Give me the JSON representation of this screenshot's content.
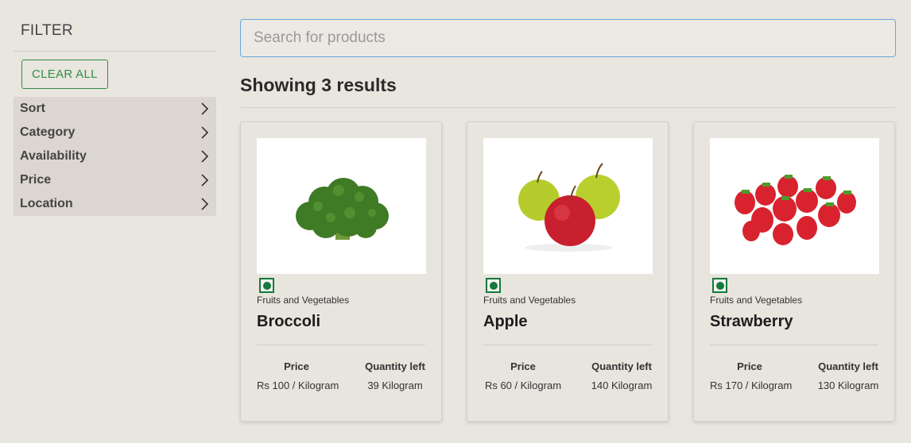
{
  "sidebar": {
    "title": "FILTER",
    "clear_label": "CLEAR ALL",
    "filters": [
      {
        "label": "Sort"
      },
      {
        "label": "Category"
      },
      {
        "label": "Availability"
      },
      {
        "label": "Price"
      },
      {
        "label": "Location"
      }
    ]
  },
  "search": {
    "placeholder": "Search for products",
    "value": ""
  },
  "results": {
    "heading": "Showing 3 results"
  },
  "labels": {
    "price": "Price",
    "quantity": "Quantity left"
  },
  "products": [
    {
      "category": "Fruits and Vegetables",
      "name": "Broccoli",
      "price": "Rs 100 / Kilogram",
      "quantity": "39 Kilogram",
      "image": "broccoli"
    },
    {
      "category": "Fruits and Vegetables",
      "name": "Apple",
      "price": "Rs 60 / Kilogram",
      "quantity": "140 Kilogram",
      "image": "apple"
    },
    {
      "category": "Fruits and Vegetables",
      "name": "Strawberry",
      "price": "Rs 170 / Kilogram",
      "quantity": "130 Kilogram",
      "image": "strawberry"
    }
  ],
  "colors": {
    "accent_green": "#2f8f46",
    "veg_mark": "#127a3a",
    "search_border": "#6aa5de"
  }
}
